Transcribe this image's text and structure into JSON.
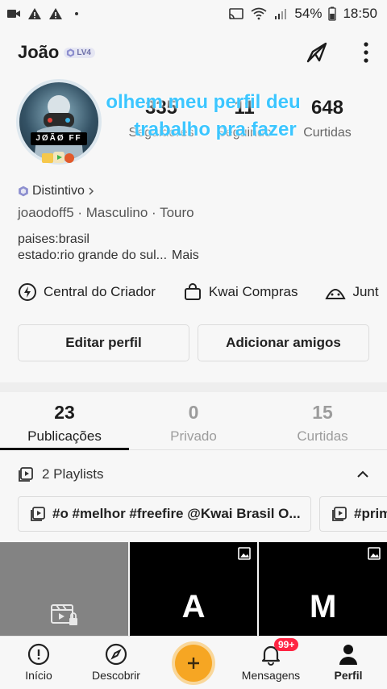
{
  "status_bar": {
    "battery": "54%",
    "time": "18:50",
    "left_icons": [
      "video-notification-icon",
      "warning-icon",
      "warning-icon",
      "dot-icon"
    ],
    "right_icons": [
      "cast-icon",
      "wifi-icon",
      "signal-icon"
    ]
  },
  "profile": {
    "name": "João",
    "level": "LV4",
    "avatar_text": "JØÃØ FF",
    "stats": [
      {
        "value": "335",
        "label": "Seguidores"
      },
      {
        "value": "11",
        "label": "Seguindo"
      },
      {
        "value": "648",
        "label": "Curtidas"
      }
    ],
    "overlay_caption_line1": "olhem meu perfil deu",
    "overlay_caption_line2": "trabalho pra fazer",
    "distintivo": "Distintivo",
    "meta": "joaodoff5 · Masculino · Touro",
    "bio_line1": "paises:brasil",
    "bio_line2": "estado:rio grande do sul...",
    "bio_more": "Mais"
  },
  "quick_links": [
    {
      "label": "Central do Criador",
      "icon": "creator-bolt-icon"
    },
    {
      "label": "Kwai Compras",
      "icon": "shopping-bag-icon"
    },
    {
      "label": "Junt",
      "icon": "tent-icon"
    }
  ],
  "buttons": {
    "edit": "Editar perfil",
    "add_friends": "Adicionar amigos"
  },
  "tabs": [
    {
      "count": "23",
      "label": "Publicações",
      "active": true
    },
    {
      "count": "0",
      "label": "Privado",
      "active": false
    },
    {
      "count": "15",
      "label": "Curtidas",
      "active": false
    }
  ],
  "playlists": {
    "header": "2 Playlists",
    "items": [
      "#o #melhor #freefire @Kwai Brasil O...",
      "#prim"
    ]
  },
  "grid": [
    {
      "letter": "",
      "style": "grey",
      "icon": "video-lock-icon"
    },
    {
      "letter": "A",
      "style": "dark",
      "icon": "image-icon"
    },
    {
      "letter": "M",
      "style": "dark",
      "icon": "image-icon"
    }
  ],
  "bottom_nav": {
    "items": [
      {
        "label": "Início",
        "icon": "home-icon"
      },
      {
        "label": "Descobrir",
        "icon": "compass-icon"
      },
      {
        "label": "",
        "icon": "plus-icon"
      },
      {
        "label": "Mensagens",
        "icon": "bell-icon",
        "badge": "99+"
      },
      {
        "label": "Perfil",
        "icon": "person-icon",
        "active": true
      }
    ]
  },
  "colors": {
    "overlay_text": "#3cc6ff",
    "create_button": "#f6a623",
    "badge": "#ff2442"
  }
}
